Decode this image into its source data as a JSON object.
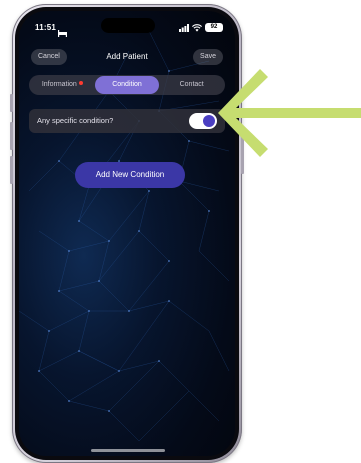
{
  "status_bar": {
    "time": "11:51",
    "battery": "92"
  },
  "nav": {
    "cancel_label": "Cancel",
    "title": "Add Patient",
    "save_label": "Save"
  },
  "tabs": [
    {
      "label": "Information",
      "has_indicator": true
    },
    {
      "label": "Condition",
      "active": true
    },
    {
      "label": "Contact"
    }
  ],
  "condition": {
    "question": "Any specific condition?",
    "toggle_on": true,
    "add_button_label": "Add New Condition"
  },
  "colors": {
    "accent": "#7f70d6",
    "button": "#3b37a6",
    "indicator_dot": "#ff3b30",
    "annotation_arrow": "#c6dd70"
  }
}
